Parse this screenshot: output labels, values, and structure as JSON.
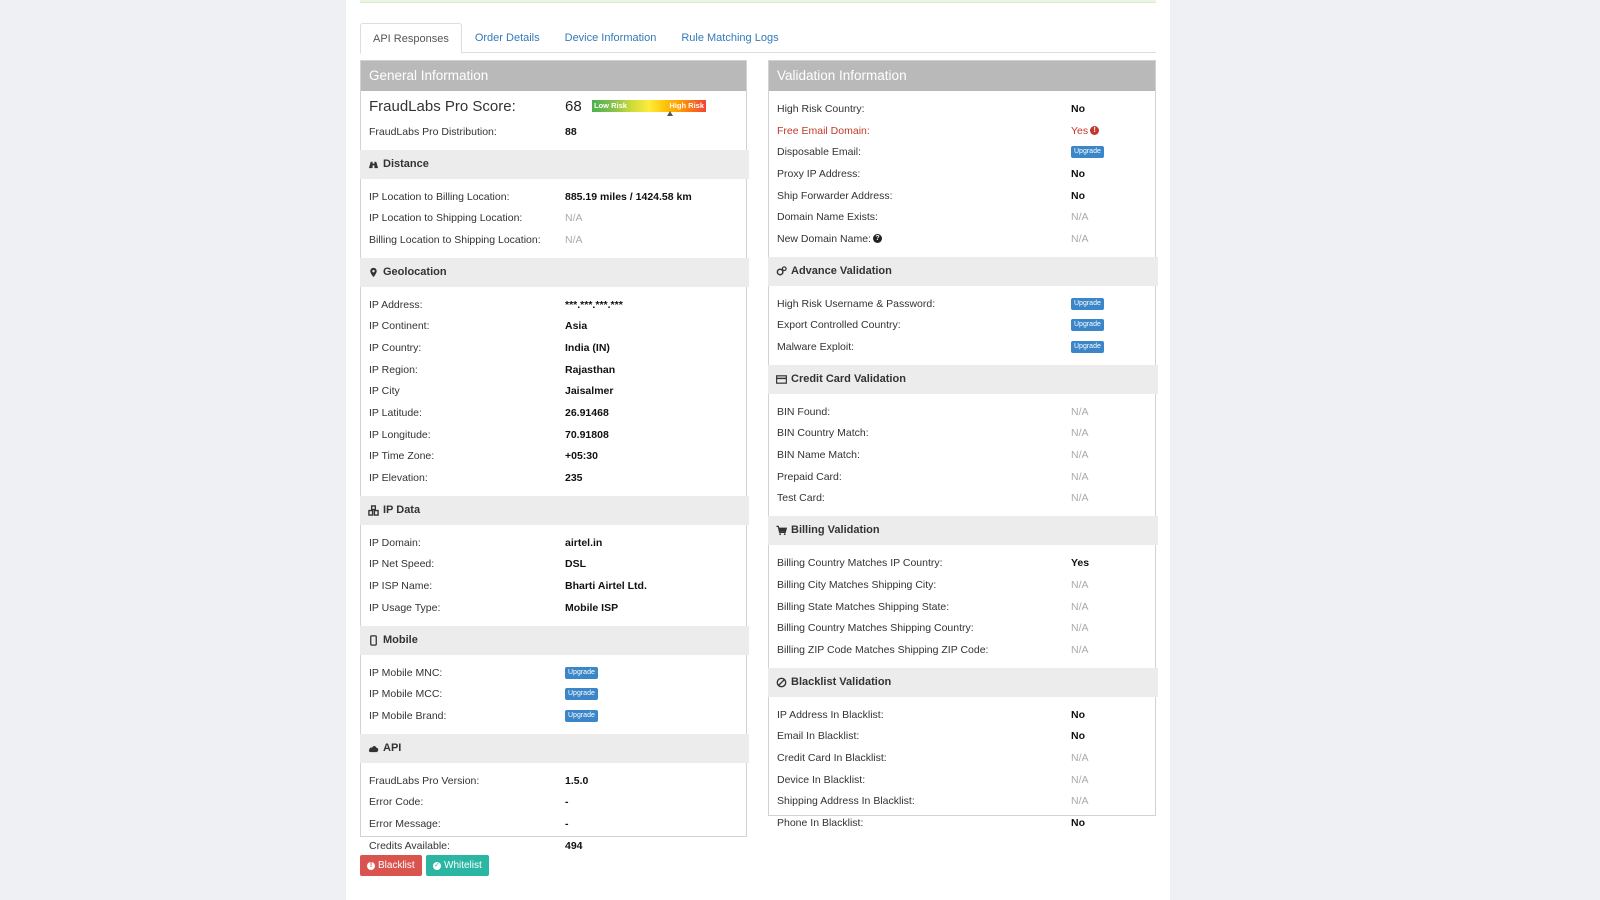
{
  "tabs": [
    "API Responses",
    "Order Details",
    "Device Information",
    "Rule Matching Logs"
  ],
  "general": {
    "heading": "General Information",
    "score_label": "FraudLabs Pro Score:",
    "score_value": "68",
    "score_fraction": 0.68,
    "meter_low": "Low Risk",
    "meter_high": "High Risk",
    "distribution_label": "FraudLabs Pro Distribution:",
    "distribution_value": "88"
  },
  "distance": {
    "title": "Distance",
    "rows": [
      {
        "label": "IP Location to Billing Location:",
        "value": "885.19 miles / 1424.58 km"
      },
      {
        "label": "IP Location to Shipping Location:",
        "value": "N/A"
      },
      {
        "label": "Billing Location to Shipping Location:",
        "value": "N/A"
      }
    ]
  },
  "geolocation": {
    "title": "Geolocation",
    "rows": [
      {
        "label": "IP Address:",
        "value": "***.***.***.***"
      },
      {
        "label": "IP Continent:",
        "value": "Asia"
      },
      {
        "label": "IP Country:",
        "value": "India (IN)"
      },
      {
        "label": "IP Region:",
        "value": "Rajasthan"
      },
      {
        "label": "IP City",
        "value": "Jaisalmer"
      },
      {
        "label": "IP Latitude:",
        "value": "26.91468"
      },
      {
        "label": "IP Longitude:",
        "value": "70.91808"
      },
      {
        "label": "IP Time Zone:",
        "value": "+05:30"
      },
      {
        "label": "IP Elevation:",
        "value": "235"
      }
    ]
  },
  "ipdata": {
    "title": "IP Data",
    "rows": [
      {
        "label": "IP Domain:",
        "value": "airtel.in"
      },
      {
        "label": "IP Net Speed:",
        "value": "DSL"
      },
      {
        "label": "IP ISP Name:",
        "value": "Bharti Airtel Ltd."
      },
      {
        "label": "IP Usage Type:",
        "value": "Mobile ISP"
      }
    ]
  },
  "mobile": {
    "title": "Mobile",
    "rows": [
      {
        "label": "IP Mobile MNC:",
        "value": "Upgrade"
      },
      {
        "label": "IP Mobile MCC:",
        "value": "Upgrade"
      },
      {
        "label": "IP Mobile Brand:",
        "value": "Upgrade"
      }
    ]
  },
  "api": {
    "title": "API",
    "rows": [
      {
        "label": "FraudLabs Pro Version:",
        "value": "1.5.0"
      },
      {
        "label": "Error Code:",
        "value": "-"
      },
      {
        "label": "Error Message:",
        "value": "-"
      },
      {
        "label": "Credits Available:",
        "value": "494"
      }
    ]
  },
  "validation": {
    "heading": "Validation Information",
    "rows": [
      {
        "label": "High Risk Country:",
        "value": "No"
      },
      {
        "label": "Free Email Domain:",
        "value": "Yes"
      },
      {
        "label": "Disposable Email:",
        "value": "Upgrade"
      },
      {
        "label": "Proxy IP Address:",
        "value": "No"
      },
      {
        "label": "Ship Forwarder Address:",
        "value": "No"
      },
      {
        "label": "Domain Name Exists:",
        "value": "N/A"
      },
      {
        "label": "New Domain Name:",
        "value": "N/A"
      }
    ]
  },
  "advance": {
    "title": "Advance Validation",
    "rows": [
      {
        "label": "High Risk Username & Password:",
        "value": "Upgrade"
      },
      {
        "label": "Export Controlled Country:",
        "value": "Upgrade"
      },
      {
        "label": "Malware Exploit:",
        "value": "Upgrade"
      }
    ]
  },
  "credit": {
    "title": "Credit Card Validation",
    "rows": [
      {
        "label": "BIN Found:",
        "value": "N/A"
      },
      {
        "label": "BIN Country Match:",
        "value": "N/A"
      },
      {
        "label": "BIN Name Match:",
        "value": "N/A"
      },
      {
        "label": "Prepaid Card:",
        "value": "N/A"
      },
      {
        "label": "Test Card:",
        "value": "N/A"
      }
    ]
  },
  "billing": {
    "title": "Billing Validation",
    "rows": [
      {
        "label": "Billing Country Matches IP Country:",
        "value": "Yes"
      },
      {
        "label": "Billing City Matches Shipping City:",
        "value": "N/A"
      },
      {
        "label": "Billing State Matches Shipping State:",
        "value": "N/A"
      },
      {
        "label": "Billing Country Matches Shipping Country:",
        "value": "N/A"
      },
      {
        "label": "Billing ZIP Code Matches Shipping ZIP Code:",
        "value": "N/A"
      }
    ]
  },
  "blacklist": {
    "title": "Blacklist Validation",
    "rows": [
      {
        "label": "IP Address In Blacklist:",
        "value": "No"
      },
      {
        "label": "Email In Blacklist:",
        "value": "No"
      },
      {
        "label": "Credit Card In Blacklist:",
        "value": "N/A"
      },
      {
        "label": "Device In Blacklist:",
        "value": "N/A"
      },
      {
        "label": "Shipping Address In Blacklist:",
        "value": "N/A"
      },
      {
        "label": "Phone In Blacklist:",
        "value": "No"
      }
    ]
  },
  "buttons": {
    "blacklist": "Blacklist",
    "whitelist": "Whitelist"
  },
  "colors": {
    "link": "#337ab7",
    "danger": "#d9534f",
    "success": "#2bb6a4",
    "badge": "#3a86c8",
    "panel_heading": "#b9b9b9"
  }
}
